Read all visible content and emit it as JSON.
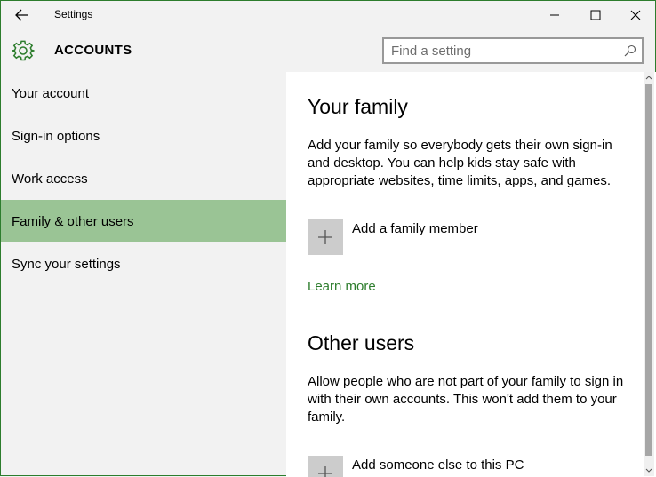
{
  "window": {
    "title": "Settings"
  },
  "header": {
    "icon": "gear-icon",
    "title": "ACCOUNTS",
    "search_placeholder": "Find a setting",
    "accent": "#2d7d2d"
  },
  "sidebar": {
    "active_color": "#9ac495",
    "items": [
      {
        "label": "Your account"
      },
      {
        "label": "Sign-in options"
      },
      {
        "label": "Work access"
      },
      {
        "label": "Family & other users",
        "active": true
      },
      {
        "label": "Sync your settings"
      }
    ]
  },
  "content": {
    "family": {
      "heading": "Your family",
      "description": "Add your family so everybody gets their own sign-in and desktop. You can help kids stay safe with appropriate websites, time limits, apps, and games.",
      "add_label": "Add a family member",
      "learn_more": "Learn more"
    },
    "other": {
      "heading": "Other users",
      "description": "Allow people who are not part of your family to sign in with their own accounts. This won't add them to your family.",
      "add_label": "Add someone else to this PC"
    }
  }
}
